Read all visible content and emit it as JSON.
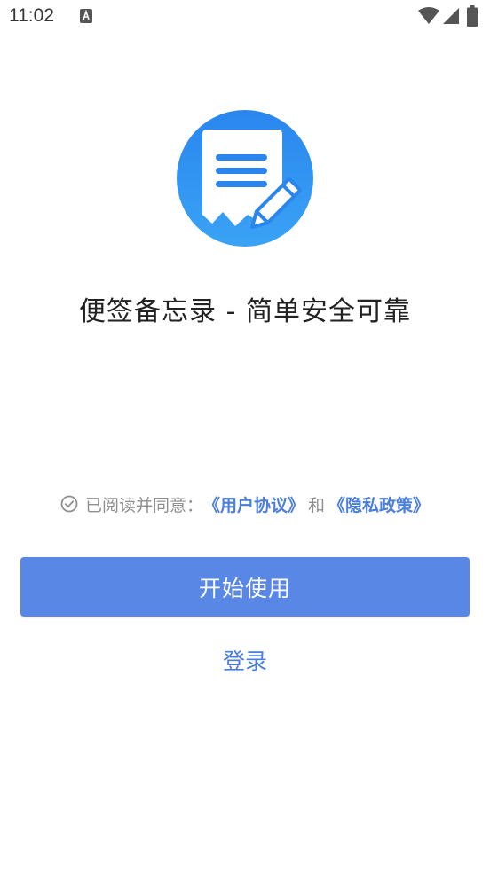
{
  "status_bar": {
    "time": "11:02",
    "notification_icon": "text-notification-icon",
    "wifi_icon": "wifi-icon",
    "signal_icon": "cell-signal-icon",
    "battery_icon": "battery-icon"
  },
  "app": {
    "logo_icon": "notepad-pencil-logo",
    "title": "便签备忘录 - 简单安全可靠"
  },
  "agreement": {
    "checked": true,
    "prefix": "已阅读并同意：",
    "user_agreement": "《用户协议》",
    "and": "和",
    "privacy_policy": "《隐私政策》"
  },
  "actions": {
    "start_label": "开始使用",
    "login_label": "登录"
  },
  "colors": {
    "accent": "#5987e6",
    "link": "#4a7fdb",
    "logo_blue": "#2f8ff0"
  }
}
